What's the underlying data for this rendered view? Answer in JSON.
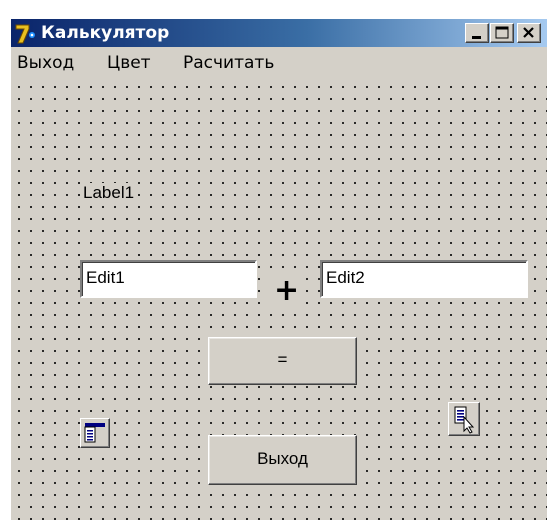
{
  "window": {
    "title": "Калькулятор",
    "controls": {
      "minimize": "minimize-icon",
      "maximize": "maximize-icon",
      "close": "close-icon"
    }
  },
  "menu": {
    "items": [
      {
        "label": "Выход"
      },
      {
        "label": "Цвет"
      },
      {
        "label": "Расчитать"
      }
    ]
  },
  "form": {
    "label1": "Label1",
    "edit1": "Edit1",
    "edit2": "Edit2",
    "operator": "+",
    "equals_button": "=",
    "exit_button": "Выход",
    "components": {
      "main_menu": "main-menu-component-icon",
      "popup_menu": "popup-menu-component-icon"
    }
  },
  "colors": {
    "face": "#d4d0c8",
    "title_start": "#0a246a",
    "title_end": "#a6caf0",
    "title_text": "#ffffff"
  }
}
